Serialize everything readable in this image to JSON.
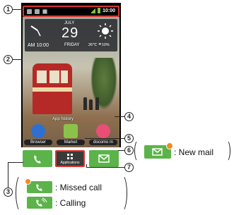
{
  "status_bar": {
    "time": "10:00"
  },
  "widget": {
    "clock_time": "AM 10:00",
    "month": "JULY",
    "day": "29",
    "weekday": "FRIDAY",
    "temperature": "26℃ ☂10%"
  },
  "home": {
    "history_label": "App history",
    "apps": [
      {
        "label": "Browser",
        "icon": "globe-icon",
        "color": "#2f6fd0"
      },
      {
        "label": "Market",
        "icon": "shopping-bag-icon",
        "color": "#8bc34a"
      },
      {
        "label": "docomo m",
        "icon": "flower-icon",
        "color": "#e94e77"
      }
    ],
    "page_indicator": "3"
  },
  "dock": {
    "phone_icon": "phone-icon",
    "apps_label": "Applications",
    "mail_icon": "mail-icon"
  },
  "callouts": [
    "1",
    "2",
    "3",
    "4",
    "5",
    "6",
    "7"
  ],
  "legend": {
    "new_mail": ": New mail",
    "missed_call": ": Missed call",
    "calling": ": Calling"
  },
  "colors": {
    "accent_red": "#d8362e",
    "dock_green": "#5bb34a",
    "badge_orange": "#f08a24"
  }
}
